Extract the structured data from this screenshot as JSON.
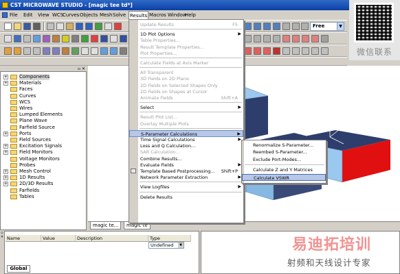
{
  "app": {
    "title": "CST MICROWAVE STUDIO - [magic tee td*]"
  },
  "menubar": {
    "items": [
      {
        "label": "File"
      },
      {
        "label": "Edit"
      },
      {
        "label": "View"
      },
      {
        "label": "WCS"
      },
      {
        "label": "Curves"
      },
      {
        "label": "Objects"
      },
      {
        "label": "Mesh"
      },
      {
        "label": "Solve"
      },
      {
        "label": "Results"
      },
      {
        "label": "Macros"
      },
      {
        "label": "Window"
      },
      {
        "label": "Help"
      }
    ]
  },
  "toolbar": {
    "free_combo": "Free"
  },
  "watermark": {
    "qr_caption": "微信联系",
    "brand_cn": "易迪拓培训",
    "brand_sub": "射频和天线设计专家"
  },
  "tree": {
    "items": [
      {
        "label": "Components",
        "expander": "+"
      },
      {
        "label": "Materials",
        "expander": "+"
      },
      {
        "label": "Faces",
        "expander": ""
      },
      {
        "label": "Curves",
        "expander": ""
      },
      {
        "label": "WCS",
        "expander": ""
      },
      {
        "label": "Wires",
        "expander": ""
      },
      {
        "label": "Lumped Elements",
        "expander": ""
      },
      {
        "label": "Plane Wave",
        "expander": ""
      },
      {
        "label": "Farfield Source",
        "expander": ""
      },
      {
        "label": "Ports",
        "expander": "+"
      },
      {
        "label": "Field Sources",
        "expander": ""
      },
      {
        "label": "Excitation Signals",
        "expander": "+"
      },
      {
        "label": "Field Monitors",
        "expander": "+"
      },
      {
        "label": "Voltage Monitors",
        "expander": ""
      },
      {
        "label": "Probes",
        "expander": ""
      },
      {
        "label": "Mesh Control",
        "expander": "+"
      },
      {
        "label": "1D Results",
        "expander": "+"
      },
      {
        "label": "2D/3D Results",
        "expander": "+"
      },
      {
        "label": "Farfields",
        "expander": ""
      },
      {
        "label": "Tables",
        "expander": ""
      }
    ]
  },
  "view_tabs": [
    {
      "label": "magic te..."
    },
    {
      "label": "magic te"
    }
  ],
  "params": {
    "columns": [
      "Name",
      "Value",
      "Description",
      "Type"
    ],
    "type_value": "Undefined",
    "global_tab": "Global"
  },
  "results_menu": {
    "items": [
      {
        "label": "Update Results",
        "shortcut": "F5",
        "disabled": true,
        "submenu": false
      },
      {
        "sep": true
      },
      {
        "label": "1D Plot Options",
        "shortcut": "",
        "disabled": false,
        "submenu": true
      },
      {
        "label": "Table Properties...",
        "shortcut": "",
        "disabled": true,
        "submenu": false
      },
      {
        "label": "Result Template Properties...",
        "shortcut": "",
        "disabled": true,
        "submenu": false
      },
      {
        "label": "Plot Properties...",
        "shortcut": "",
        "disabled": true,
        "submenu": false
      },
      {
        "sep": true
      },
      {
        "label": "Calculate Fields at Axis Marker",
        "shortcut": "",
        "disabled": true,
        "submenu": false
      },
      {
        "sep": true
      },
      {
        "label": "All Transparent",
        "shortcut": "",
        "disabled": true,
        "submenu": false
      },
      {
        "label": "3D Fields on 2D Plane",
        "shortcut": "",
        "disabled": true,
        "submenu": false
      },
      {
        "label": "2D Fields on Selected Shapes Only",
        "shortcut": "",
        "disabled": true,
        "submenu": false
      },
      {
        "label": "2D Fields on Shapes at Cursor",
        "shortcut": "",
        "disabled": true,
        "submenu": false
      },
      {
        "label": "Animate Fields",
        "shortcut": "Shift+A",
        "disabled": true,
        "submenu": false
      },
      {
        "sep": true
      },
      {
        "label": "Select",
        "shortcut": "",
        "disabled": false,
        "submenu": true
      },
      {
        "sep": true
      },
      {
        "label": "Result Plot List...",
        "shortcut": "",
        "disabled": true,
        "submenu": false
      },
      {
        "label": "Overlay Multiple Plots",
        "shortcut": "",
        "disabled": true,
        "submenu": false
      },
      {
        "sep": true
      },
      {
        "label": "S-Parameter Calculations",
        "shortcut": "",
        "disabled": false,
        "submenu": true,
        "highlight": true
      },
      {
        "label": "Time Signal Calculations",
        "shortcut": "",
        "disabled": false,
        "submenu": true
      },
      {
        "label": "Loss and Q Calculation...",
        "shortcut": "",
        "disabled": false,
        "submenu": false
      },
      {
        "label": "SAR Calculation...",
        "shortcut": "",
        "disabled": true,
        "submenu": false
      },
      {
        "label": "Combine Results...",
        "shortcut": "",
        "disabled": false,
        "submenu": false
      },
      {
        "label": "Evaluate Fields",
        "shortcut": "",
        "disabled": false,
        "submenu": true
      },
      {
        "label": "Template Based Postprocessing...",
        "shortcut": "Shift+P",
        "disabled": false,
        "submenu": false,
        "icon": true
      },
      {
        "label": "Network Parameter Extraction",
        "shortcut": "",
        "disabled": false,
        "submenu": true
      },
      {
        "sep": true
      },
      {
        "label": "View Logfiles",
        "shortcut": "",
        "disabled": false,
        "submenu": true
      },
      {
        "sep": true
      },
      {
        "label": "Delete Results",
        "shortcut": "",
        "disabled": false,
        "submenu": false
      }
    ]
  },
  "sparam_submenu": {
    "items": [
      {
        "label": "Renormalize S-Parameter..."
      },
      {
        "label": "Reembed S-Parameter..."
      },
      {
        "label": "Exclude Port-Modes..."
      },
      {
        "sep": true
      },
      {
        "label": "Calculate Z and Y Matrices"
      },
      {
        "label": "Calculate VSWR",
        "highlight": true
      }
    ]
  }
}
